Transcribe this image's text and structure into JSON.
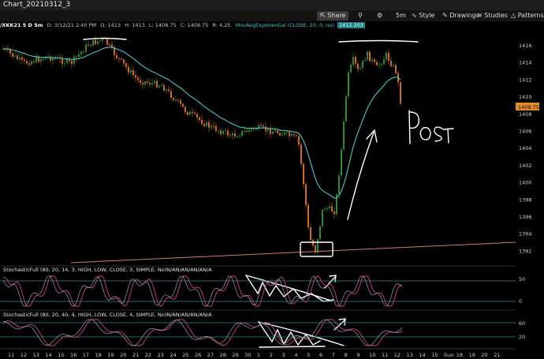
{
  "window": {
    "title": "Chart_20210312_3"
  },
  "toolbar": {
    "share": "Share",
    "aggregation": "5m",
    "style": "Style",
    "drawings": "Drawings",
    "studies": "Studies",
    "patterns": "Patterns"
  },
  "header": {
    "symbol": "/XKK21 5 D 5m",
    "datetime": "D: 3/12/21 2:40 PM",
    "open": "O: 1413",
    "high": "H: 1413",
    "low": "L: 1408.75",
    "close": "C: 1408.75",
    "range": "R: 4.25",
    "study_name": "MovAvgExponential (CLOSE, 20, 0, no)",
    "study_value": "1412.203"
  },
  "price_axis": {
    "ticks": [
      "1416",
      "1414",
      "1412",
      "1410",
      "1408",
      "1406",
      "1404",
      "1402",
      "1400",
      "1398",
      "1396",
      "1394",
      "1392"
    ],
    "last_price": "1408.75"
  },
  "stoch1": {
    "label": "StochasticFull (80, 20, 14, 3, HIGH, LOW, CLOSE, 3, SIMPLE, No)N/AN/AN/AN/AN/A",
    "ticks": [
      "50",
      "0"
    ]
  },
  "stoch2": {
    "label": "StochasticFull (80, 20, 40, 4, HIGH, LOW, CLOSE, 4, SIMPLE, No)N/AN/AN/AN/AN/A",
    "ticks": [
      "60",
      "20"
    ]
  },
  "time_axis": [
    "11",
    "12",
    "13",
    "14",
    "15",
    "16",
    "17",
    "18",
    "19",
    "20",
    "21",
    "22",
    "23",
    "24",
    "25",
    "26",
    "27",
    "28",
    "29",
    "30",
    "1",
    "2",
    "3",
    "4",
    "5",
    "6",
    "7",
    "8",
    "9",
    "10",
    "11",
    "12",
    "13",
    "14",
    "15",
    "Sun",
    "18",
    "19",
    "20",
    "21"
  ],
  "annotation": {
    "text": "POST"
  },
  "colors": {
    "up": "#2e8b2e",
    "down": "#d2691e",
    "ema": "#3ec9c9",
    "grid": "#1e5a5e"
  }
}
